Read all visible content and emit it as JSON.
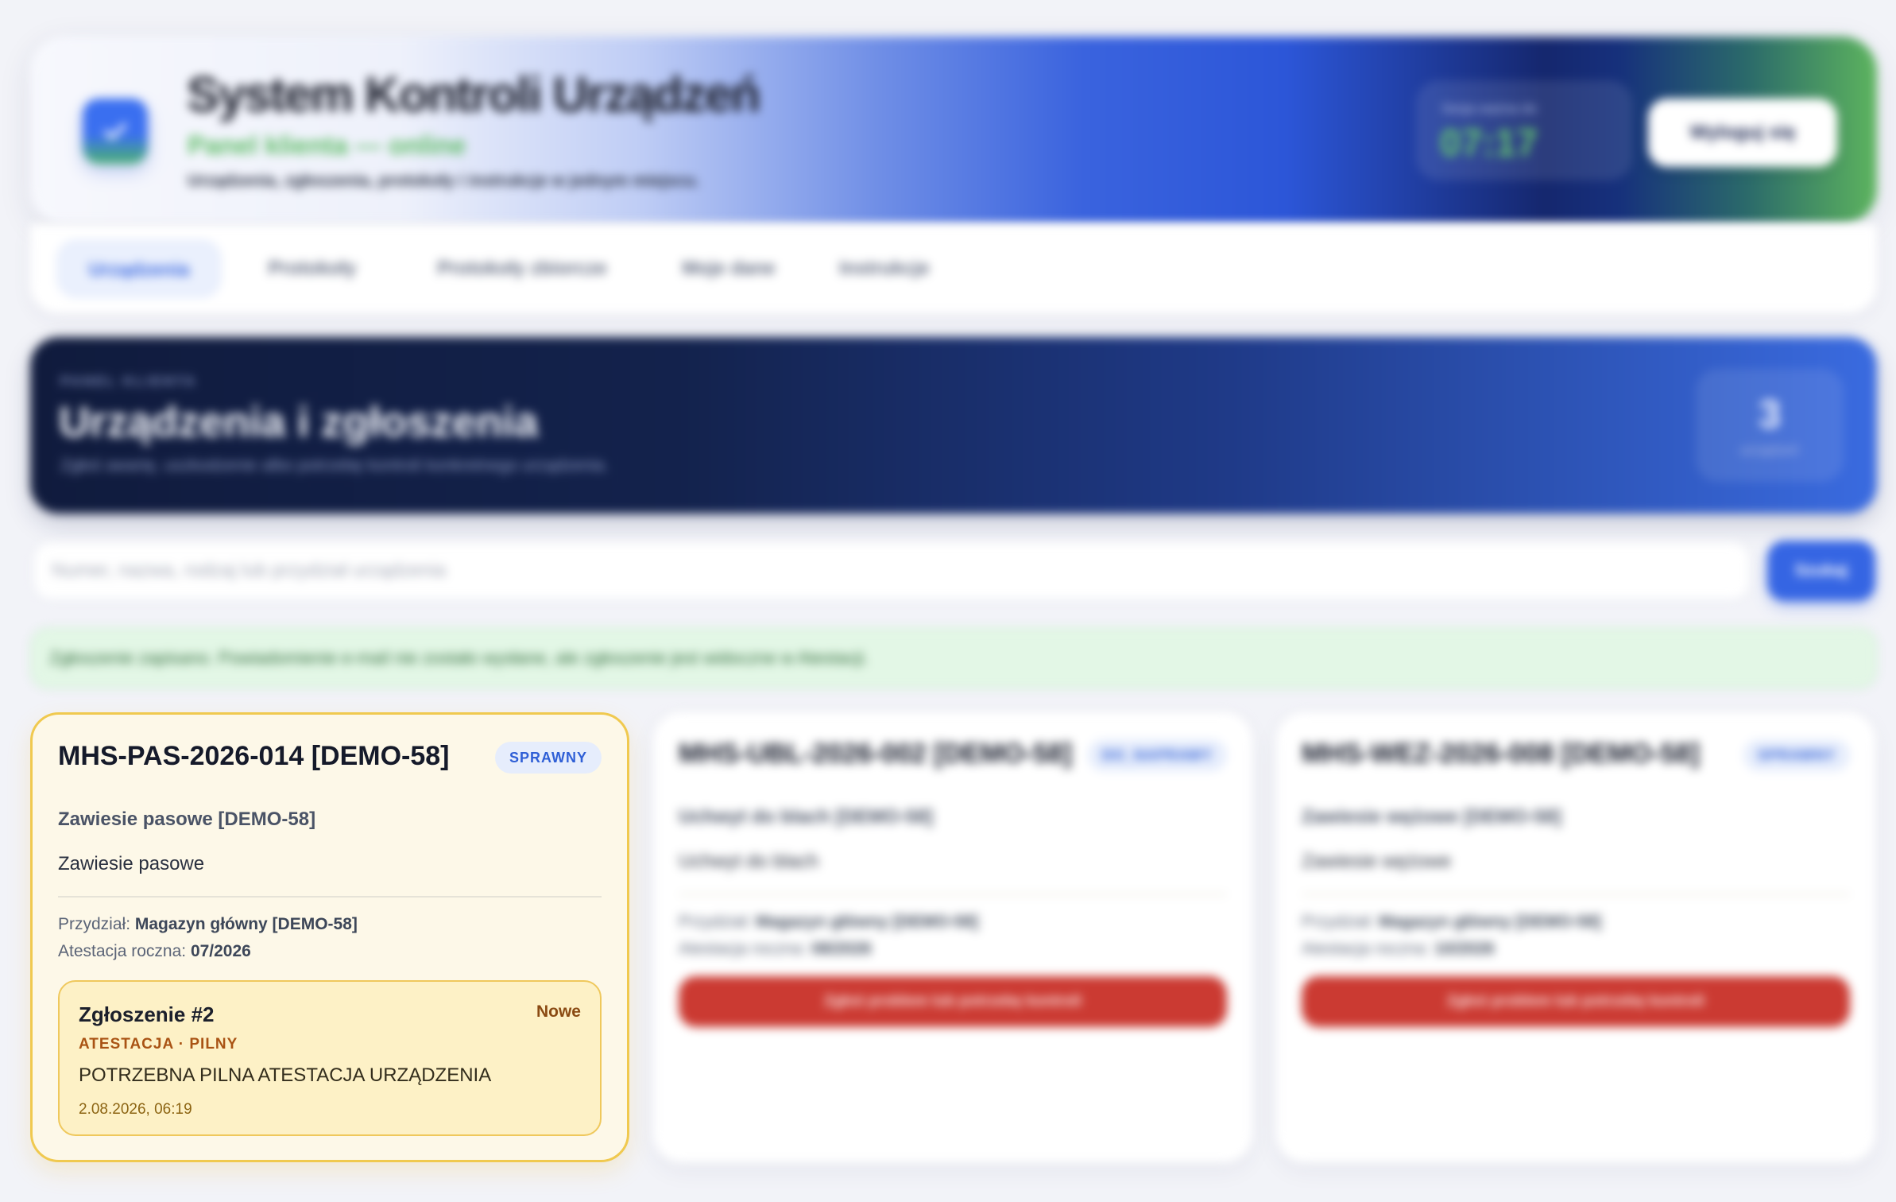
{
  "header": {
    "title": "System Kontroli Urządzeń",
    "subtitle": "Panel klienta — online",
    "description": "Urządzenia, zgłoszenia, protokoły i instrukcje w jednym miejscu.",
    "session_label": "Sesja ważna do",
    "session_time": "07:17",
    "logout_label": "Wyloguj się",
    "logo_icon": "check-icon"
  },
  "nav": {
    "tabs": [
      {
        "label": "Urządzenia",
        "active": true
      },
      {
        "label": "Protokoły",
        "active": false
      },
      {
        "label": "Protokoły zbiorcze",
        "active": false
      },
      {
        "label": "Moje dane",
        "active": false
      },
      {
        "label": "Instrukcje",
        "active": false
      }
    ]
  },
  "hero": {
    "eyebrow": "PANEL KLIENTA",
    "title": "Urządzenia i zgłoszenia",
    "description": "Zgłoś awarię, uszkodzenie albo potrzebę kontroli konkretnego urządzenia.",
    "count": "3",
    "count_label": "urządzeń"
  },
  "search": {
    "placeholder": "Numer, nazwa, rodzaj lub przydział urządzenia",
    "button_label": "Szukaj"
  },
  "notice": {
    "text": "Zgłoszenie zapisano. Powiadomienie e-mail nie zostało wysłane, ale zgłoszenie jest widoczne w Atestacji."
  },
  "devices": [
    {
      "title": "MHS-PAS-2026-014 [DEMO-58]",
      "status": "SPRAWNY",
      "type": "Zawiesie pasowe [DEMO-58]",
      "kind": "Zawiesie pasowe",
      "assignment_label": "Przydział:",
      "assignment": "Magazyn główny [DEMO-58]",
      "attestation_label": "Atestacja roczna:",
      "attestation": "07/2026",
      "ticket": {
        "title": "Zgłoszenie #2",
        "status": "Nowe",
        "tag": "ATESTACJA · PILNY",
        "description": "POTRZEBNA PILNA ATESTACJA URZĄDZENIA",
        "date": "2.08.2026, 06:19"
      }
    },
    {
      "title": "MHS-UBL-2026-002 [DEMO-58]",
      "status": "DO_NAPRAWY",
      "type": "Uchwyt do blach [DEMO-58]",
      "kind": "Uchwyt do blach",
      "assignment_label": "Przydział:",
      "assignment": "Magazyn główny [DEMO-58]",
      "attestation_label": "Atestacja roczna:",
      "attestation": "08/2026",
      "report_label": "Zgłoś problem lub potrzebę kontroli"
    },
    {
      "title": "MHS-WEZ-2026-008 [DEMO-58]",
      "status": "SPRAWNY",
      "type": "Zawiesie wężowe [DEMO-58]",
      "kind": "Zawiesie wężowe",
      "assignment_label": "Przydział:",
      "assignment": "Magazyn główny [DEMO-58]",
      "attestation_label": "Atestacja roczna:",
      "attestation": "10/2026",
      "report_label": "Zgłoś problem lub potrzebę kontroli"
    }
  ]
}
